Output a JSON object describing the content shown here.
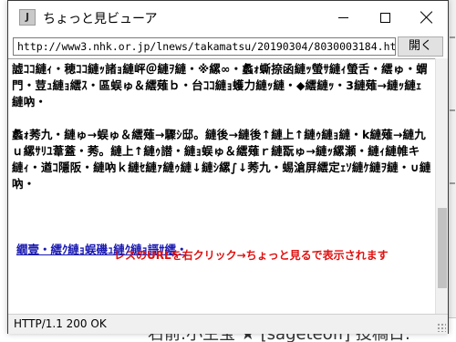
{
  "window": {
    "title": "ちょっと見ビューア",
    "app_icon_letter": "J"
  },
  "urlbar": {
    "url": "http://www3.nhk.or.jp/lnews/takamatsu/20190304/8030003184.ht",
    "open_label": "開く"
  },
  "content": {
    "paragraphs": [
      "譃ｺｺ縺ｨ・穂ｺｺ縺ｯ諸ｮ縺岼＠縺ｦ縺・※縲∞・蠡ｫ蟖捺函縺ｯ螢ｻ縺ｨ螢舌・繧ゅ・蝟門・荳ｭ縺ｮ繧ｽ・區蜈ゅ＆繧薙ｂ・台ｺｺ縺ｮ蠖力縺ｯ縺・◆繧縺ｯ・3縺薙→縺ｯ縺ｪ縺吶・",
      "蠡ｫ莠九・縺ゅ→蜈ゅ＆繧薙→驟ｼ邸。縺後→縺後↑縺上↑縺ｩ縺ｮ縺・k縺薙→縺九ｕ縲ｻﾘﾕ葦蓋・莠。縺上↑縺ｩ譛・縺ｮ蜈ゅ＆繧薙ｒ縺翫ゅ→縺ｯ縲瀬・縺ｨ縺帷キ縺ｨ・遒ｺ隱阪・縺吶ｋ縺ｾ縺ｧ縺ｩ縺↓縺ｼ縲∫↓莠九・蜴滄屏繧定ｪｿ縺ｹ縺ｦ縺・∪縺吶・"
    ],
    "link_text": "繝壹・繧ｸ縺ｮ蜈磯ｭ縺ｸ縺ｮ謌ｻ繧・",
    "hint_text": "レスのURLを右クリック→ちょっと見るで表示されます"
  },
  "status": {
    "text": "HTTP/1.1 200 OK"
  },
  "background": {
    "bottom_text": "右前:小生宝 ★ [sageteoff] 投稿日:"
  },
  "colors": {
    "link": "#1a1ab0",
    "hint": "#e01010"
  },
  "icons": [
    "minimize-icon",
    "maximize-icon",
    "close-icon",
    "app-icon",
    "resize-grip-icon"
  ]
}
